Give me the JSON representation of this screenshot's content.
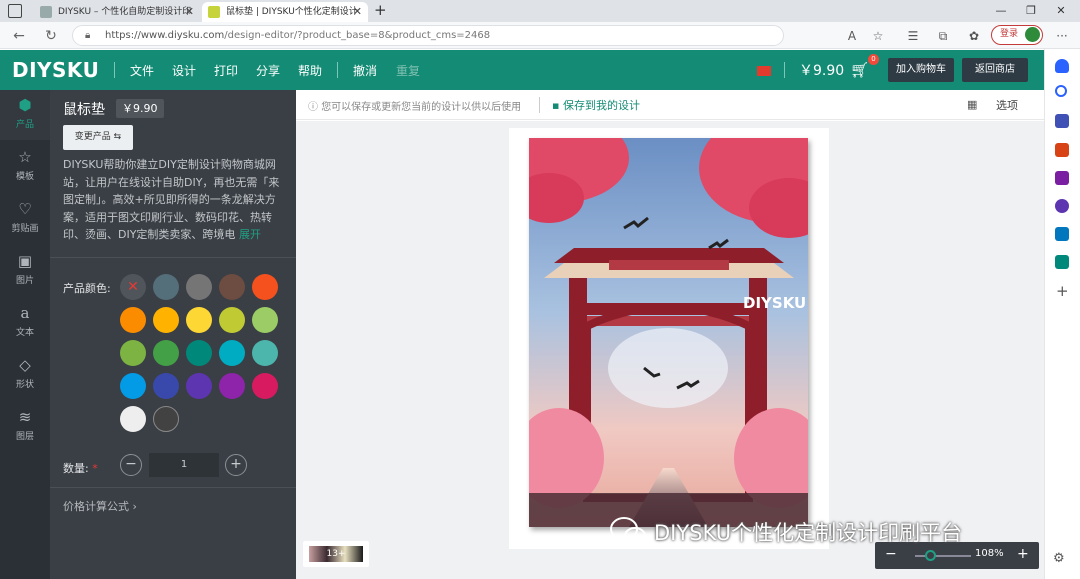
{
  "browser": {
    "tabs": [
      {
        "title": "DIYSKU – 个性化自助定制设计印",
        "active": false
      },
      {
        "title": "鼠标垫 | DIYSKU个性化定制设计",
        "active": true
      }
    ],
    "new_tab": "+",
    "url_host": "https://www.diysku.com",
    "url_path": "/design-editor/?product_base=8&product_cms=2468",
    "login_label": "登录"
  },
  "header": {
    "logo": "DIYSKU",
    "menu": [
      "文件",
      "设计",
      "打印",
      "分享",
      "帮助"
    ],
    "undo": "撤消",
    "redo": "重复",
    "price": "￥9.90",
    "cart_count": "0",
    "add_to_cart": "加入购物车",
    "back_to_shop": "返回商店"
  },
  "rail": [
    {
      "icon": "cube-icon",
      "label": "产品",
      "active": true
    },
    {
      "icon": "star-icon",
      "label": "模板",
      "active": false
    },
    {
      "icon": "heart-icon",
      "label": "剪贴画",
      "active": false
    },
    {
      "icon": "image-icon",
      "label": "图片",
      "active": false
    },
    {
      "icon": "text-icon",
      "label": "文本",
      "active": false
    },
    {
      "icon": "diamond-icon",
      "label": "形状",
      "active": false
    },
    {
      "icon": "layers-icon",
      "label": "图层",
      "active": false
    }
  ],
  "panel": {
    "title": "鼠标垫",
    "price": "￥9.90",
    "change_product": "变更产品 ⇆",
    "description": "DIYSKU帮助你建立DIY定制设计购物商城网站，让用户在线设计自助DIY，再也无需「来图定制」。高效+所见即所得的一条龙解决方案，适用于图文印刷行业、数码印花、热转印、烫画、DIY定制类卖家、跨境电",
    "expand": "展开",
    "color_label": "产品颜色:",
    "colors": [
      "none",
      "#546e7a",
      "#757575",
      "#6d4c41",
      "#f4511e",
      "#fb8c00",
      "#ffb300",
      "#fdd835",
      "#c0ca33",
      "#9ccc65",
      "#7cb342",
      "#43a047",
      "#00897b",
      "#00acc1",
      "#4db6ac",
      "#039be5",
      "#3949ab",
      "#5e35b1",
      "#8e24aa",
      "#d81b60",
      "#eeeeee",
      "#424242"
    ],
    "quantity_label": "数量:",
    "quantity_required": "*",
    "quantity_value": "1",
    "minus": "−",
    "plus": "+",
    "price_formula": "价格计算公式 ›"
  },
  "toolbar": {
    "tip": "您可以保存或更新您当前的设计以供以后使用",
    "save": "保存到我的设计",
    "options": "选项"
  },
  "canvas": {
    "artwork_text": "DIYSKU",
    "thumb_label": "13+",
    "zoom_level": "108%",
    "zoom_minus": "−",
    "zoom_plus": "+"
  },
  "watermark": "DIYSKU个性化定制设计印刷平台"
}
